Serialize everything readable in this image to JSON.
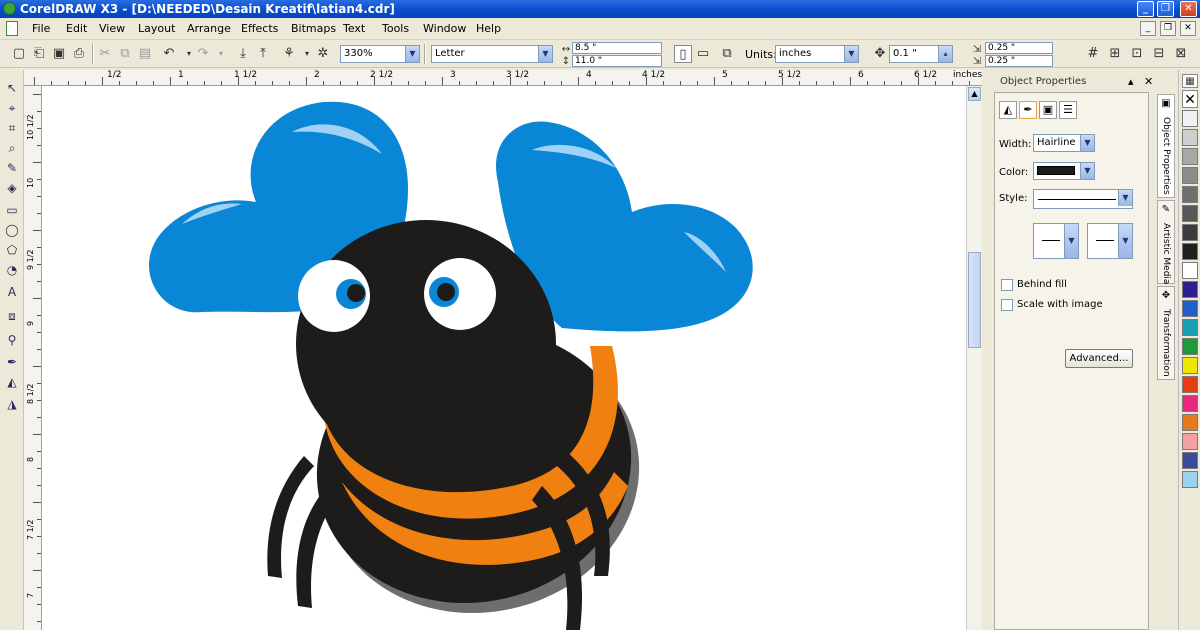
{
  "title": "CorelDRAW X3 - [D:\\NEEDED\\Desain Kreatif\\latian4.cdr]",
  "window_controls": {
    "minimize": "_",
    "restore": "❐",
    "close": "✕"
  },
  "menu": [
    "File",
    "Edit",
    "View",
    "Layout",
    "Arrange",
    "Effects",
    "Bitmaps",
    "Text",
    "Tools",
    "Window",
    "Help"
  ],
  "toolbar": {
    "zoom": "330%",
    "paper": "Letter",
    "width": "8.5 \"",
    "height": "11.0 \"",
    "units_label": "Units:",
    "units": "inches",
    "nudge": "0.1 \"",
    "dup_x": "0.25 \"",
    "dup_y": "0.25 \""
  },
  "ruler": {
    "top_labels": [
      "1/2",
      "1",
      "1 1/2",
      "2",
      "2 1/2",
      "3",
      "3 1/2",
      "4",
      "4 1/2",
      "5",
      "5 1/2",
      "6",
      "6 1/2",
      "inches"
    ],
    "left_labels": [
      "10 1/2",
      "10",
      "9 1/2",
      "9",
      "8 1/2",
      "8",
      "7 1/2",
      "7"
    ]
  },
  "docker": {
    "title": "Object Properties",
    "width_label": "Width:",
    "width_value": "Hairline",
    "color_label": "Color:",
    "style_label": "Style:",
    "behind_fill": "Behind fill",
    "scale_with_image": "Scale with image",
    "advanced": "Advanced..."
  },
  "side_tabs": [
    "Object Properties",
    "Artistic Media",
    "Transformation"
  ],
  "palette": [
    "#f0f0f0",
    "#cfcfcf",
    "#a8a8a8",
    "#8c8c8c",
    "#707070",
    "#585858",
    "#3c3c3c",
    "#1e1e1e",
    "#ffffff",
    "#2d1f8f",
    "#1f5fc8",
    "#19a0b4",
    "#1c9b3a",
    "#f0e600",
    "#e63c14",
    "#e8287c",
    "#e6781e",
    "#f4a0a0",
    "#3c4a9a",
    "#9ad2f0"
  ],
  "colors": {
    "wing": "#0a86d6",
    "body": "#1e1c1b",
    "stripe": "#f08010",
    "shadow": "#6e6e6e"
  }
}
